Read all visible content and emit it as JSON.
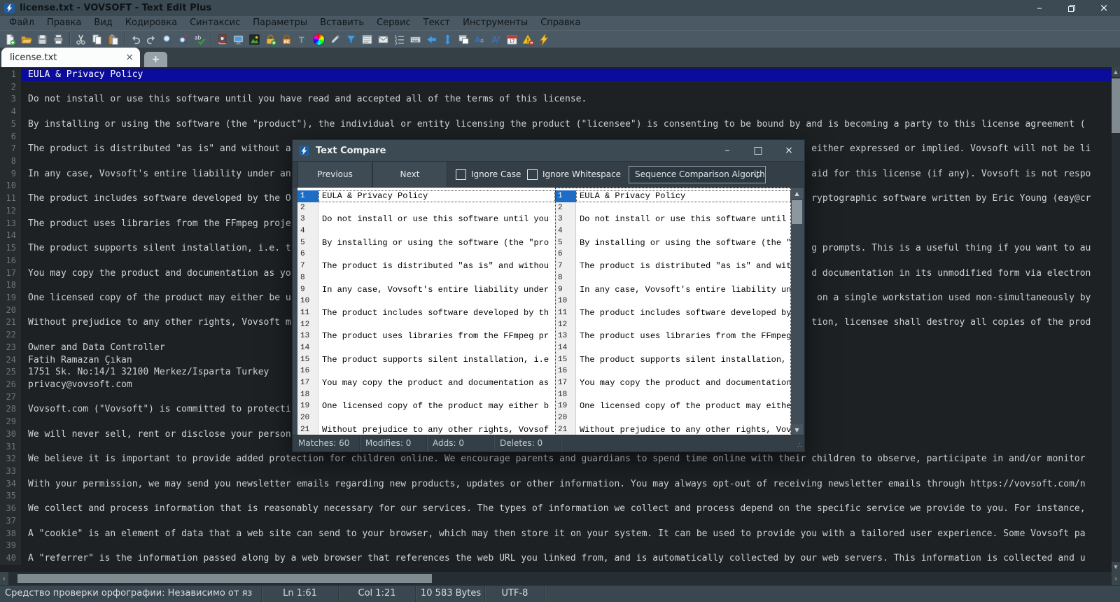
{
  "colors": {
    "chrome": "#4a5963",
    "titlebar": "#3b4a53",
    "tabbar": "#353f46",
    "editor_bg": "#1d2124",
    "gutter_bg": "#262b2e",
    "selection": "#0b0b9c",
    "dialog_chrome": "#3b4a53",
    "dialog_toolbar": "#333e46",
    "pane_gutter": "#efefef",
    "row_highlight": "#1d6cc5",
    "statusbar": "#3a4750",
    "accent_blue": "#4f9bd8"
  },
  "window": {
    "title": "license.txt - VOVSOFT - Text Edit Plus",
    "controls": {
      "minimize": "–",
      "close": "×"
    }
  },
  "menu": {
    "items": [
      "Файл",
      "Правка",
      "Вид",
      "Кодировка",
      "Синтаксис",
      "Параметры",
      "Вставить",
      "Сервис",
      "Текст",
      "Инструменты",
      "Справка"
    ]
  },
  "toolbar": {
    "icons": [
      "new-file",
      "open-folder",
      "save",
      "print",
      "sep",
      "cut",
      "copy",
      "paste",
      "sep",
      "undo",
      "redo",
      "search",
      "find-replace",
      "spell-check",
      "sep",
      "dictionary-search",
      "monitor",
      "picture",
      "lock-add",
      "lock-edit",
      "font-style",
      "color-wheel",
      "pen",
      "filter",
      "panel-list",
      "email",
      "numbered-list",
      "keyboard",
      "nav-back",
      "sort-updown",
      "duplicate-window",
      "font-smaller",
      "font-larger",
      "calendar",
      "warning-remove",
      "lightning"
    ]
  },
  "tabs": {
    "active": "license.txt",
    "close": "×",
    "add": "+"
  },
  "editor": {
    "total_lines": 40,
    "lines": [
      {
        "n": 1,
        "text": "EULA & Privacy Policy",
        "selected": true
      },
      {
        "n": 3,
        "text": "Do not install or use this software until you have read and accepted all of the terms of this license."
      },
      {
        "n": 5,
        "text": "By installing or using the software (the \"product\"), the individual or entity licensing the product (\"licensee\") is consenting to be bound by and is becoming a party to this license agreement ("
      },
      {
        "n": 7,
        "left": "The product is distributed \"as is\" and without a",
        "right": "either expressed or implied. Vovsoft will not be li",
        "rightCol": 143
      },
      {
        "n": 9,
        "left": "In any case, Vovsoft's entire liability under an",
        "right": "aid for this license (if any). Vovsoft is not respo",
        "rightCol": 143
      },
      {
        "n": 11,
        "left": "The product includes software developed by the O",
        "right": "ryptographic software written by Eric Young (eay@cr",
        "rightCol": 143
      },
      {
        "n": 13,
        "text": "The product uses libraries from the FFmpeg proje"
      },
      {
        "n": 15,
        "left": "The product supports silent installation, i.e. t",
        "right": "g prompts. This is a useful thing if you want to au",
        "rightCol": 143
      },
      {
        "n": 17,
        "left": "You may copy the product and documentation as yo",
        "right": "d documentation in its unmodified form via electron",
        "rightCol": 143
      },
      {
        "n": 19,
        "left": "One licensed copy of the product may either be u",
        "right": "on a single workstation used non-simultaneously by",
        "rightCol": 144
      },
      {
        "n": 21,
        "left": "Without prejudice to any other rights, Vovsoft m",
        "right": "tion, licensee shall destroy all copies of the prod",
        "rightCol": 143
      },
      {
        "n": 23,
        "text": "Owner and Data Controller"
      },
      {
        "n": 24,
        "text": "Fatih Ramazan Çıkan"
      },
      {
        "n": 25,
        "text": "1751 Sk. No:14/1 32100 Merkez/Isparta Turkey"
      },
      {
        "n": 26,
        "text": "privacy@vovsoft.com"
      },
      {
        "n": 28,
        "text": "Vovsoft.com (\"Vovsoft\") is committed to protecti"
      },
      {
        "n": 30,
        "text": "We will never sell, rent or disclose your person"
      },
      {
        "n": 32,
        "text": "We believe it is important to provide added protection for children online. We encourage parents and guardians to spend time online with their children to observe, participate in and/or monitor"
      },
      {
        "n": 34,
        "text": "With your permission, we may send you newsletter emails regarding new products, updates or other information. You may always opt-out of receiving newsletter emails through https://vovsoft.com/n"
      },
      {
        "n": 36,
        "text": "We collect and process information that is reasonably necessary for our services. The types of information we collect and process depend on the specific service we provide to you. For instance,"
      },
      {
        "n": 38,
        "text": "A \"cookie\" is an element of data that a web site can send to your browser, which may then store it on your system. It can be used to provide you with a tailored user experience. Some Vovsoft pa"
      },
      {
        "n": 40,
        "text": "A \"referrer\" is the information passed along by a web browser that references the web URL you linked from, and is automatically collected by our web servers. This information is collected and u"
      }
    ]
  },
  "dialog": {
    "title": "Text Compare",
    "controls": {
      "minimize": "–",
      "maximize": "□",
      "close": "×"
    },
    "toolbar": {
      "previous": "Previous",
      "next": "Next",
      "ignore_case": "Ignore Case",
      "ignore_whitespace": "Ignore Whitespace",
      "algorithm": "Sequence Comparison Algorithm"
    },
    "panes": {
      "total_rows": 21,
      "lines": [
        {
          "n": 1,
          "text": "EULA & Privacy Policy",
          "highlight": true
        },
        {
          "n": 3,
          "text": "Do not install or use this software until you"
        },
        {
          "n": 5,
          "text": "By installing or using the software (the \"pro"
        },
        {
          "n": 7,
          "text": "The product is distributed \"as is\" and withou"
        },
        {
          "n": 9,
          "text": "In any case, Vovsoft's entire liability under"
        },
        {
          "n": 11,
          "text": "The product includes software developed by th"
        },
        {
          "n": 13,
          "text": "The product uses libraries from the FFmpeg pr"
        },
        {
          "n": 15,
          "text": "The product supports silent installation, i.e"
        },
        {
          "n": 17,
          "text": "You may copy the product and documentation as"
        },
        {
          "n": 19,
          "text": "One licensed copy of the product may either b"
        },
        {
          "n": 21,
          "text": "Without prejudice to any other rights, Vovsof"
        }
      ]
    },
    "status": [
      "Matches: 60",
      "Modifies: 0",
      "Adds: 0",
      "Deletes: 0"
    ]
  },
  "statusbar": {
    "cells": [
      "Средство проверки орфографии: Независимо от яз",
      "Ln 1:61",
      "Col 1:21",
      "10 583 Bytes",
      "UTF-8"
    ]
  }
}
